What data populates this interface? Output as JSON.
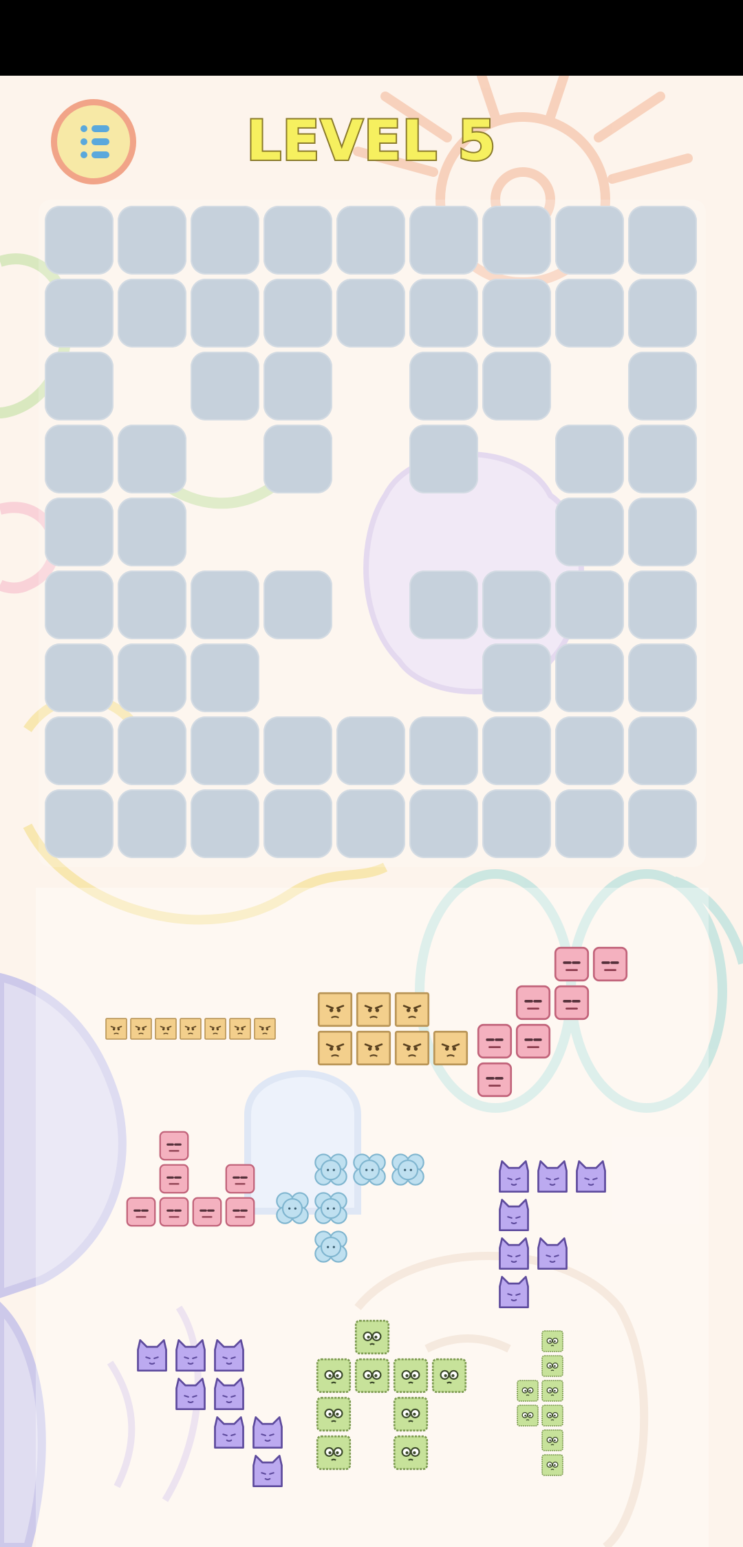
{
  "header": {
    "level_title": "LEVEL 5",
    "menu_icon": "list-menu-icon"
  },
  "colors": {
    "cell": "#c6d1dc",
    "orange_monster": "#f3cf8c",
    "pink_monster": "#f4b1bf",
    "blue_monster": "#bfe0f0",
    "purple_monster": "#bcaaf0",
    "green_monster": "#c7e29a"
  },
  "board": {
    "rows": 9,
    "cols": 9,
    "grid": [
      "111111111",
      "111111111",
      "101101101",
      "110101011",
      "110000011",
      "111101111",
      "111000111",
      "111111111",
      "111111111"
    ]
  },
  "pieces": [
    {
      "name": "orange-mini-line-piece",
      "monster": "orange",
      "cells": [
        [
          0,
          0
        ],
        [
          0,
          1
        ],
        [
          0,
          2
        ],
        [
          0,
          3
        ],
        [
          0,
          4
        ],
        [
          0,
          5
        ],
        [
          0,
          6
        ]
      ]
    },
    {
      "name": "orange-block-piece",
      "monster": "orange",
      "cells": [
        [
          0,
          0
        ],
        [
          0,
          1
        ],
        [
          0,
          2
        ],
        [
          1,
          0
        ],
        [
          1,
          1
        ],
        [
          1,
          2
        ],
        [
          1,
          3
        ]
      ]
    },
    {
      "name": "pink-zigzag-piece",
      "monster": "pink",
      "cells": [
        [
          0,
          2
        ],
        [
          0,
          3
        ],
        [
          1,
          1
        ],
        [
          1,
          2
        ],
        [
          2,
          0
        ],
        [
          2,
          1
        ],
        [
          3,
          0
        ]
      ]
    },
    {
      "name": "pink-l-piece",
      "monster": "pink",
      "cells": [
        [
          0,
          1
        ],
        [
          1,
          1
        ],
        [
          1,
          3
        ],
        [
          2,
          0
        ],
        [
          2,
          1
        ],
        [
          2,
          2
        ],
        [
          2,
          3
        ]
      ]
    },
    {
      "name": "blue-bubble-piece",
      "monster": "blue",
      "cells": [
        [
          0,
          1
        ],
        [
          0,
          2
        ],
        [
          0,
          3
        ],
        [
          1,
          0
        ],
        [
          1,
          1
        ],
        [
          2,
          1
        ]
      ]
    },
    {
      "name": "purple-cat-piece-right",
      "monster": "purple",
      "cells": [
        [
          0,
          0
        ],
        [
          0,
          1
        ],
        [
          0,
          2
        ],
        [
          1,
          0
        ],
        [
          2,
          0
        ],
        [
          2,
          1
        ],
        [
          3,
          0
        ]
      ]
    },
    {
      "name": "purple-cat-stairs-piece",
      "monster": "purple",
      "cells": [
        [
          0,
          0
        ],
        [
          0,
          1
        ],
        [
          0,
          2
        ],
        [
          1,
          1
        ],
        [
          1,
          2
        ],
        [
          2,
          2
        ],
        [
          2,
          3
        ],
        [
          3,
          3
        ]
      ]
    },
    {
      "name": "green-fuzzy-piece",
      "monster": "green",
      "cells": [
        [
          0,
          1
        ],
        [
          1,
          0
        ],
        [
          1,
          1
        ],
        [
          1,
          2
        ],
        [
          1,
          3
        ],
        [
          2,
          0
        ],
        [
          2,
          2
        ],
        [
          3,
          0
        ],
        [
          3,
          2
        ]
      ]
    },
    {
      "name": "green-mini-column-piece",
      "monster": "green",
      "cells": [
        [
          0,
          1
        ],
        [
          1,
          1
        ],
        [
          2,
          0
        ],
        [
          2,
          1
        ],
        [
          3,
          0
        ],
        [
          3,
          1
        ],
        [
          4,
          1
        ],
        [
          5,
          1
        ]
      ]
    }
  ]
}
